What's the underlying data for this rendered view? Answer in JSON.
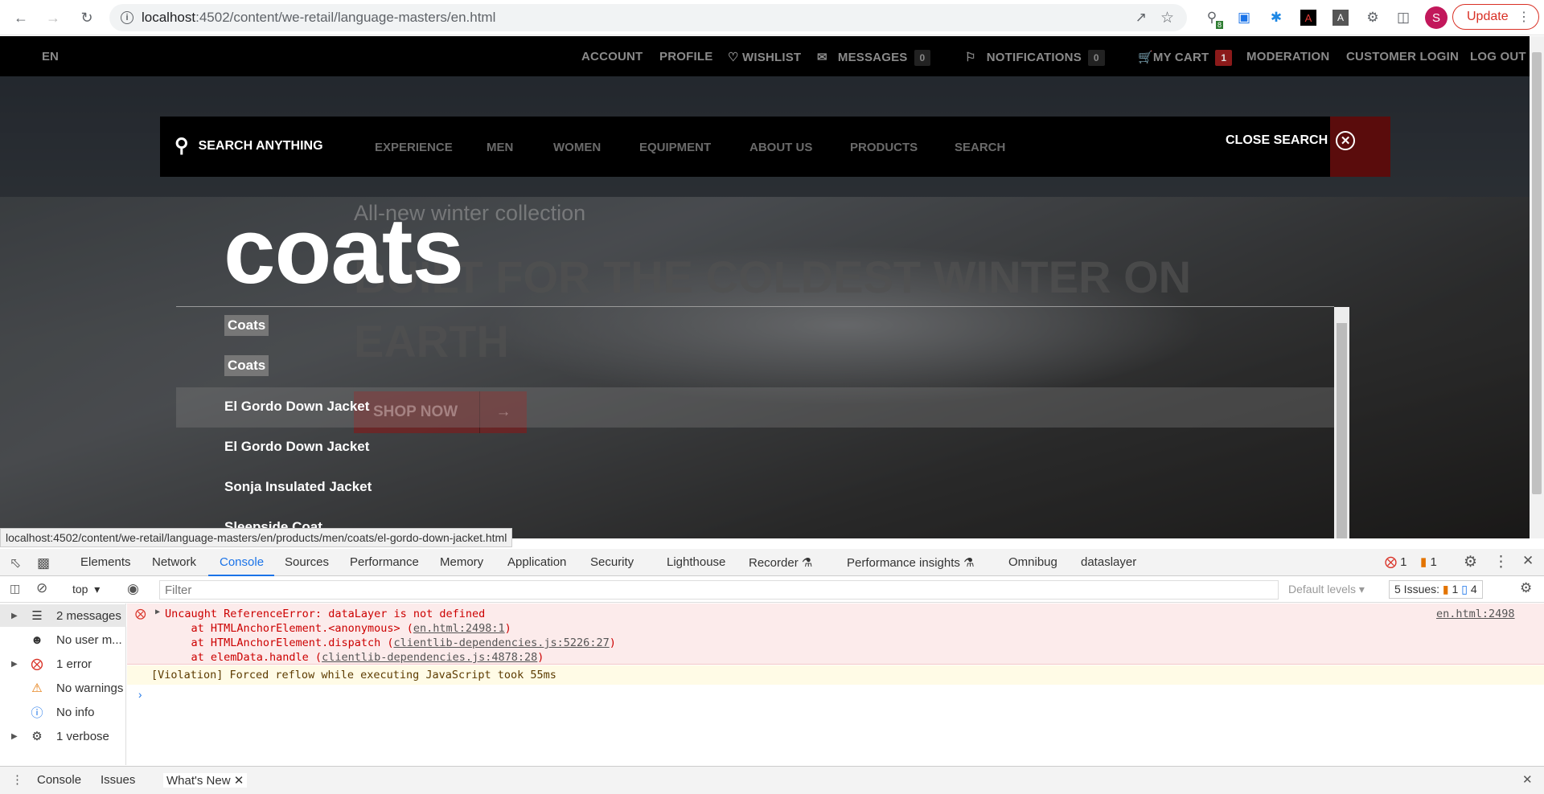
{
  "browser": {
    "url_host": "localhost",
    "url_path": ":4502/content/we-retail/language-masters/en.html",
    "update_label": "Update",
    "profile_initial": "S",
    "ext_badge": "8"
  },
  "topnav": {
    "lang": "EN",
    "account": "ACCOUNT",
    "profile": "PROFILE",
    "wishlist": "WISHLIST",
    "messages": "MESSAGES",
    "messages_count": "0",
    "notifications": "NOTIFICATIONS",
    "notifications_count": "0",
    "cart": "MY CART",
    "cart_count": "1",
    "moderation": "MODERATION",
    "customer_login": "CUSTOMER LOGIN",
    "logout": "LOG OUT"
  },
  "mainnav": {
    "search_anything": "SEARCH ANYTHING",
    "items": [
      "EXPERIENCE",
      "MEN",
      "WOMEN",
      "EQUIPMENT",
      "ABOUT US",
      "PRODUCTS",
      "SEARCH"
    ],
    "close_search": "CLOSE SEARCH"
  },
  "hero": {
    "subtitle": "All-new winter collection",
    "heading": "BUILT FOR THE COLDEST WINTER ON EARTH",
    "cta": "SHOP NOW"
  },
  "search": {
    "query": "coats",
    "results": [
      "Coats",
      "Coats",
      "El Gordo Down Jacket",
      "El Gordo Down Jacket",
      "Sonja Insulated Jacket",
      "Sleepside Coat"
    ]
  },
  "status_url": "localhost:4502/content/we-retail/language-masters/en/products/men/coats/el-gordo-down-jacket.html",
  "devtools": {
    "tabs": [
      "Elements",
      "Network",
      "Console",
      "Sources",
      "Performance",
      "Memory",
      "Application",
      "Security",
      "Lighthouse",
      "Recorder",
      "Performance insights",
      "Omnibug",
      "dataslayer"
    ],
    "error_count": "1",
    "warn_count": "1",
    "context": "top",
    "filter_placeholder": "Filter",
    "default_levels": "Default levels",
    "issues_label": "5 Issues:",
    "issues_warn": "1",
    "issues_info": "4",
    "sidebar": [
      "2 messages",
      "No user m...",
      "1 error",
      "No warnings",
      "No info",
      "1 verbose"
    ],
    "error_msg": "Uncaught ReferenceError: dataLayer is not defined",
    "stack1_pre": "    at HTMLAnchorElement.<anonymous> (",
    "stack1_link": "en.html:2498:1",
    "stack2_pre": "    at HTMLAnchorElement.dispatch (",
    "stack2_link": "clientlib-dependencies.js:5226:27",
    "stack3_pre": "    at elemData.handle (",
    "stack3_link": "clientlib-dependencies.js:4878:28",
    "error_source": "en.html:2498",
    "violation": "[Violation] Forced reflow while executing JavaScript took 55ms",
    "drawer_tabs": [
      "Console",
      "Issues",
      "What's New"
    ]
  },
  "colors": {
    "accent": "#1a73e8",
    "error": "#d93025",
    "brand_red": "#8b1a1a"
  }
}
